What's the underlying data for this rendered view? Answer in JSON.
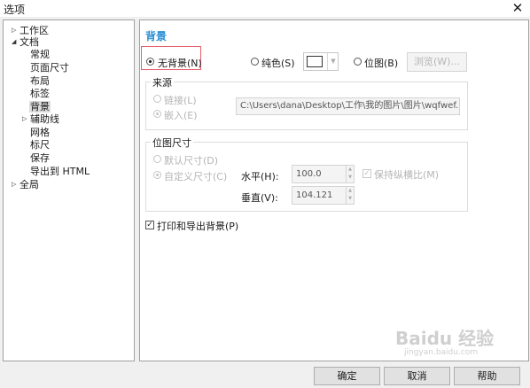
{
  "window": {
    "title": "选项"
  },
  "tree": {
    "items": [
      {
        "label": "工作区",
        "expander": "collapsed"
      },
      {
        "label": "文档",
        "expander": "expanded"
      },
      {
        "label": "常规"
      },
      {
        "label": "页面尺寸"
      },
      {
        "label": "布局"
      },
      {
        "label": "标签"
      },
      {
        "label": "背景",
        "selected": true
      },
      {
        "label": "辅助线",
        "expander": "collapsed"
      },
      {
        "label": "网格"
      },
      {
        "label": "标尺"
      },
      {
        "label": "保存"
      },
      {
        "label": "导出到 HTML"
      },
      {
        "label": "全局",
        "expander": "collapsed"
      }
    ]
  },
  "background": {
    "heading": "背景",
    "no_background": "无背景(N)",
    "solid": "纯色(S)",
    "bitmap": "位图(B)",
    "browse": "浏览(W)...",
    "selected_option": "无背景(N)",
    "solid_color": "#ffffff"
  },
  "source": {
    "title": "来源",
    "link": "链接(L)",
    "embed": "嵌入(E)",
    "path": "C:\\Users\\dana\\Desktop\\工作\\我的图片\\图片\\wqfwef.pnc",
    "selected_option": "嵌入(E)"
  },
  "bitmap_size": {
    "title": "位图尺寸",
    "default_size": "默认尺寸(D)",
    "custom_size": "自定义尺寸(C)",
    "horizontal_label": "水平(H):",
    "horizontal_value": "100.0",
    "vertical_label": "垂直(V):",
    "vertical_value": "104.121",
    "keep_ratio": "保持纵横比(M)",
    "keep_ratio_checked": true,
    "selected_option": "自定义尺寸(C)"
  },
  "print_export": {
    "label": "打印和导出背景(P)",
    "checked": true
  },
  "buttons": {
    "ok": "确定",
    "cancel": "取消",
    "help": "帮助"
  },
  "watermark": {
    "text": "Baidu 经验",
    "subtext": "jingyan.baidu.com"
  }
}
